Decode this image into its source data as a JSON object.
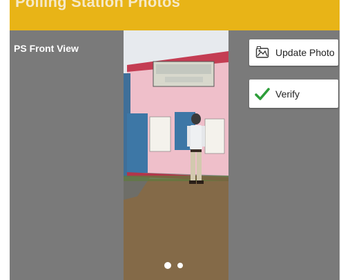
{
  "header": {
    "title": "Polling Station Photos"
  },
  "photo": {
    "label": "PS Front View",
    "pages": 2,
    "current_page": 1
  },
  "buttons": {
    "update_photo": "Update Photo",
    "verify": "Verify"
  },
  "colors": {
    "header": "#e8b417",
    "background": "#7a7a7a",
    "verify_check": "#2e9e3a"
  },
  "icons": {
    "update_photo": "image-icon",
    "verify": "checkmark-icon"
  }
}
